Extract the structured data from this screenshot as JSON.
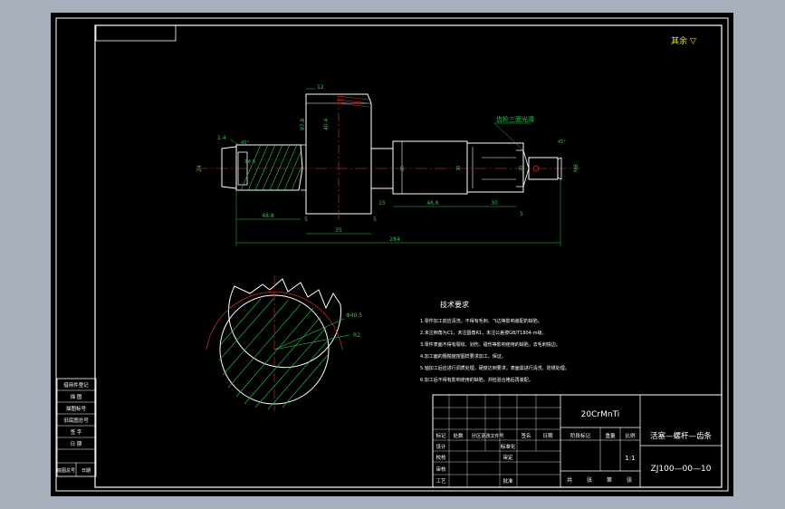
{
  "surface_finish": {
    "label": "其余",
    "symbol": "▽"
  },
  "annotations": {
    "callout": "齿轮三面光滑",
    "bevel_left": "45°",
    "bevel_right": "45°"
  },
  "dimensions": {
    "d_12": "12",
    "d_97_8": "97.8",
    "d_40_4": "40.4",
    "d_1_4": "1.4",
    "d_24": "24",
    "d_14_5": "14.5",
    "d_48_8": "48.8",
    "d_5a": "5",
    "d_35": "35",
    "d_5b": "5",
    "d_15": "15",
    "d_46_6": "46.6",
    "d_30": "30",
    "d_n5": "5",
    "d_25": "25",
    "d_30b": "30",
    "d_20": "20",
    "d_284": "284",
    "d_m8": "M8",
    "d_40_5": "Φ40.5",
    "d_r2": "R2"
  },
  "tech_requirements": {
    "title": "技术要求",
    "items": [
      "1.零件加工前应清洗，不得有毛刺、飞边等影响装配的缺陷。",
      "2.未注倒角为C1，未注圆角R1，未注公差按GB/T1804-m级。",
      "3.零件表面不得有裂纹、划伤、碰伤等影响使用的缺陷，去毛刺锐边。",
      "4.加工面的粗糙度按图样要求加工，保证。",
      "5.轴加工后应进行调质处理，硬度达到要求，表面需进行清洗、防锈处理。",
      "6.加工后不得有影响使用的缺陷，并检验合格后再装配。"
    ]
  },
  "left_strip": [
    "借用件登记",
    "描 图",
    "描图标号",
    "旧底图总号",
    "签 字",
    "日 期",
    "底图总号",
    "日期"
  ],
  "title_block": {
    "material": "20CrMnTi",
    "part_name": "活塞—螺杆—齿条",
    "drawing_no": "ZJ100—00—10",
    "scale": "1:1",
    "rev_headers": [
      "标记",
      "处数",
      "分区",
      "更改文件号",
      "签名",
      "日期"
    ],
    "rows": [
      [
        "设计",
        "",
        "标准化",
        ""
      ],
      [
        "校核",
        "",
        "审定",
        ""
      ],
      [
        "审核",
        "",
        "",
        ""
      ],
      [
        "工艺",
        "",
        "批准",
        ""
      ]
    ],
    "stage_headers": [
      "阶段标记",
      "重量",
      "比例"
    ],
    "footer": [
      "共",
      "张",
      "第",
      "张"
    ]
  }
}
